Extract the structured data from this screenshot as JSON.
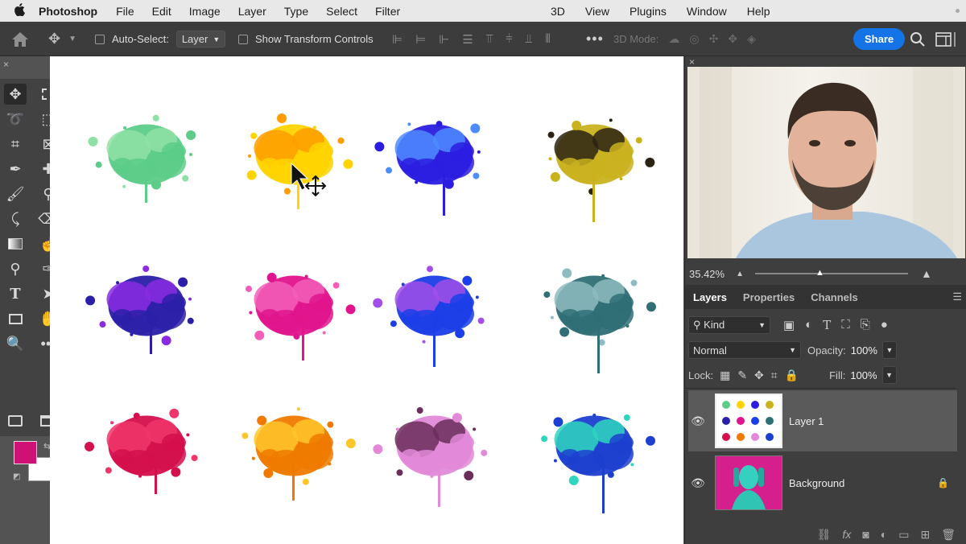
{
  "menubar": {
    "app_name": "Photoshop",
    "left_menus": [
      "File",
      "Edit",
      "Image",
      "Layer",
      "Type",
      "Select",
      "Filter"
    ],
    "right_menus": [
      "3D",
      "View",
      "Plugins",
      "Window",
      "Help"
    ]
  },
  "options": {
    "auto_select_label": "Auto-Select:",
    "auto_select_value": "Layer",
    "show_transform_label": "Show Transform Controls",
    "mode_3d_label": "3D Mode:",
    "share_label": "Share"
  },
  "colors": {
    "foreground": "#cf1174",
    "background": "#ffffff",
    "accent": "#1473e6"
  },
  "video_panel": {
    "zoom_level": "35.42%"
  },
  "panels": {
    "tabs": [
      "Layers",
      "Properties",
      "Channels"
    ],
    "active_tab": "Layers",
    "filter_kind": "Kind",
    "blend_mode": "Normal",
    "opacity_label": "Opacity:",
    "opacity_value": "100%",
    "lock_label": "Lock:",
    "fill_label": "Fill:",
    "fill_value": "100%",
    "layers": [
      {
        "name": "Layer 1",
        "visible": true,
        "locked": false,
        "selected": true
      },
      {
        "name": "Background",
        "visible": true,
        "locked": true,
        "selected": false
      }
    ]
  },
  "canvas": {
    "splatters": [
      {
        "color": "#5ccc88",
        "accent": "#8fe0a5"
      },
      {
        "color": "#ffd400",
        "accent": "#ff9c00"
      },
      {
        "color": "#2b1de0",
        "accent": "#4c8cff"
      },
      {
        "color": "#c9b21e",
        "accent": "#2a2313"
      },
      {
        "color": "#2b1fa8",
        "accent": "#8a2be2"
      },
      {
        "color": "#e0148c",
        "accent": "#f25fb8"
      },
      {
        "color": "#1b3ee8",
        "accent": "#a24fe8"
      },
      {
        "color": "#2f6f75",
        "accent": "#8fbcc0"
      },
      {
        "color": "#d50f4c",
        "accent": "#f0356b"
      },
      {
        "color": "#f07a00",
        "accent": "#ffc62a"
      },
      {
        "color": "#e28ad8",
        "accent": "#6b2e5a"
      },
      {
        "color": "#1d3fd0",
        "accent": "#2ed6c0"
      }
    ]
  }
}
